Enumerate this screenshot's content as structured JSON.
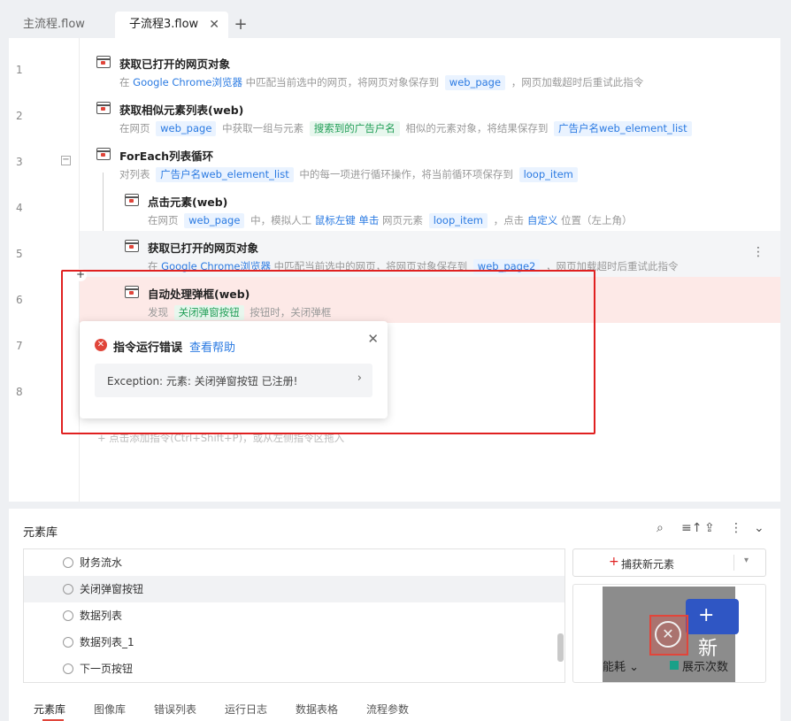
{
  "tabs": [
    {
      "label": "主流程.flow"
    },
    {
      "label": "子流程3.flow",
      "close": "✕"
    }
  ],
  "tab_add": "+",
  "lines": [
    "1",
    "2",
    "3",
    "4",
    "5",
    "6",
    "7",
    "8"
  ],
  "commands": [
    {
      "title": "获取已打开的网页对象",
      "desc": {
        "pre": "在 ",
        "link": "Google Chrome浏览器",
        "mid": " 中匹配当前选中的网页，将网页对象保存到 ",
        "chip": "web_page",
        "post": " ，网页加载超时后重试此指令"
      }
    },
    {
      "title": "获取相似元素列表(web)",
      "desc": {
        "pre": "在网页 ",
        "chip1": "web_page",
        "mid1": " 中获取一组与元素 ",
        "chip2": "搜索到的广告户名",
        "mid2": " 相似的元素对象，将结果保存到 ",
        "chip3": "广告户名web_element_list"
      }
    },
    {
      "title": "ForEach列表循环",
      "desc": {
        "pre": "对列表 ",
        "chip1": "广告户名web_element_list",
        "mid": " 中的每一项进行循环操作，将当前循环项保存到 ",
        "chip2": "loop_item"
      }
    },
    {
      "title": "点击元素(web)",
      "desc": {
        "pre": "在网页 ",
        "chip1": "web_page",
        "mid1": " 中，模拟人工 ",
        "link1": "鼠标左键",
        "sp": " ",
        "link2": "单击",
        "mid2": " 网页元素 ",
        "chip2": "loop_item",
        "mid3": " ，点击 ",
        "link3": "自定义",
        "post": " 位置（左上角）"
      }
    },
    {
      "title": "获取已打开的网页对象",
      "desc": {
        "pre": "在 ",
        "link": "Google Chrome浏览器",
        "mid": " 中匹配当前选中的网页，将网页对象保存到 ",
        "chip": "web_page2",
        "post": " ，网页加载超时后重试此指令"
      },
      "more": "⋮"
    },
    {
      "title": "自动处理弹框(web)",
      "desc": {
        "pre": "发现 ",
        "chip": "关闭弹窗按钮",
        "post": " 按钮时，关闭弹框"
      }
    }
  ],
  "collapse_symbol": "−",
  "insert_symbol": "+",
  "add_hint": "+  点击添加指令(Ctrl+Shift+P)，或从左侧指令区拖入",
  "error_popup": {
    "icon": "✕",
    "title": "指令运行错误",
    "help": "查看帮助",
    "close": "✕",
    "message": "Exception: 元素: 关闭弹窗按钮 已注册!",
    "chevron": "›"
  },
  "element_panel": {
    "title": "元素库",
    "tools": {
      "search": "⌕",
      "sort": "≡↑",
      "upload": "⇪",
      "more": "⋮",
      "collapse": "⌄"
    },
    "items": [
      "财务流水",
      "关闭弹窗按钮",
      "数据列表",
      "数据列表_1",
      "下一页按钮"
    ],
    "selected_index": 1,
    "capture_plus": "+",
    "capture_label": "捕获新元素",
    "capture_dropdown": "▾",
    "preview": {
      "plus": "+ 新",
      "close": "✕",
      "text1": "能耗 ⌄",
      "text2": "展示次数"
    },
    "bottom_tabs": [
      "元素库",
      "图像库",
      "错误列表",
      "运行日志",
      "数据表格",
      "流程参数"
    ]
  }
}
